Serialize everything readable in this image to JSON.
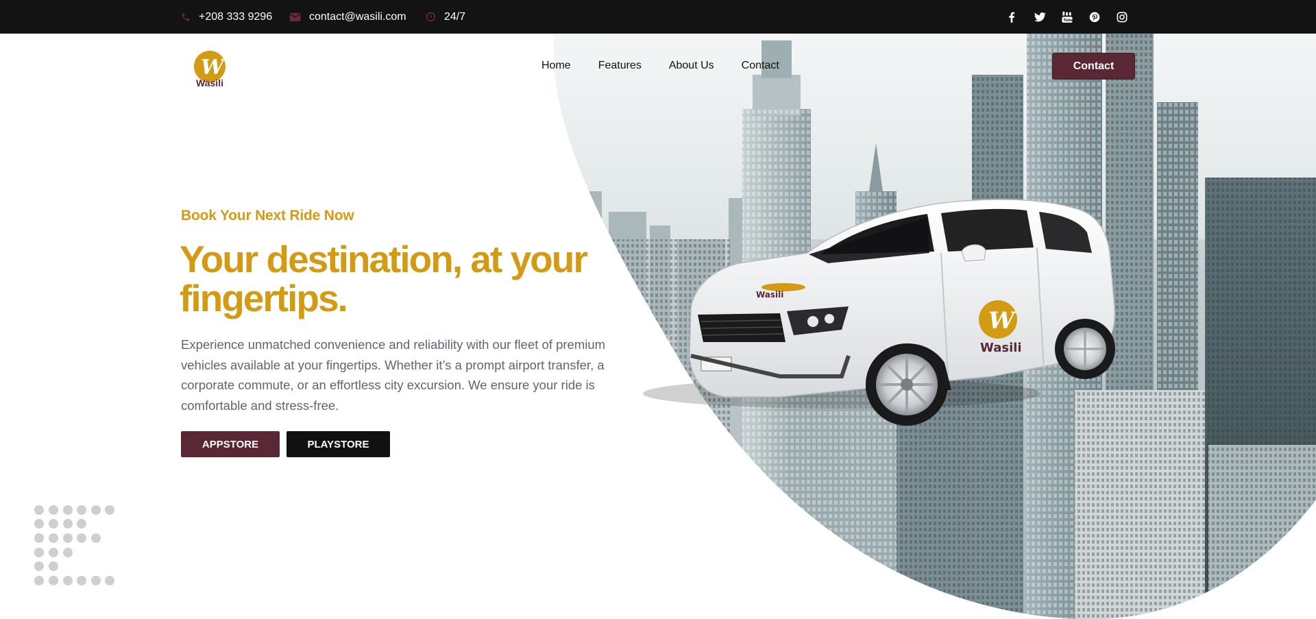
{
  "topbar": {
    "phone": "+208 333 9296",
    "email": "contact@wasili.com",
    "hours": "24/7",
    "icons": [
      "phone-icon",
      "envelope-icon",
      "clock-icon"
    ],
    "social": [
      "facebook-icon",
      "twitter-icon",
      "youtube-icon",
      "pinterest-icon",
      "instagram-icon"
    ]
  },
  "brand": {
    "name": "Wasili",
    "logo_letter": "W",
    "car_brand_text": "Wasili",
    "colors": {
      "gold": "#d39a13",
      "maroon": "#5a2734",
      "dark": "#131313"
    }
  },
  "nav": {
    "items": [
      "Home",
      "Features",
      "About Us",
      "Contact"
    ],
    "cta_label": "Contact"
  },
  "hero": {
    "eyebrow": "Book Your Next Ride Now",
    "headline_line1": "Your destination, at your",
    "headline_line2": "fingertips.",
    "body_line1": "Experience unmatched convenience and reliability with our fleet of premium",
    "body_line2": "vehicles available at your fingertips. Whether it’s a prompt airport transfer, a",
    "body_line3": "corporate commute, or an effortless city excursion. We ensure your ride is",
    "body_line4": "comfortable and stress-free.",
    "appstore_label": "APPSTORE",
    "playstore_label": "PLAYSTORE"
  }
}
